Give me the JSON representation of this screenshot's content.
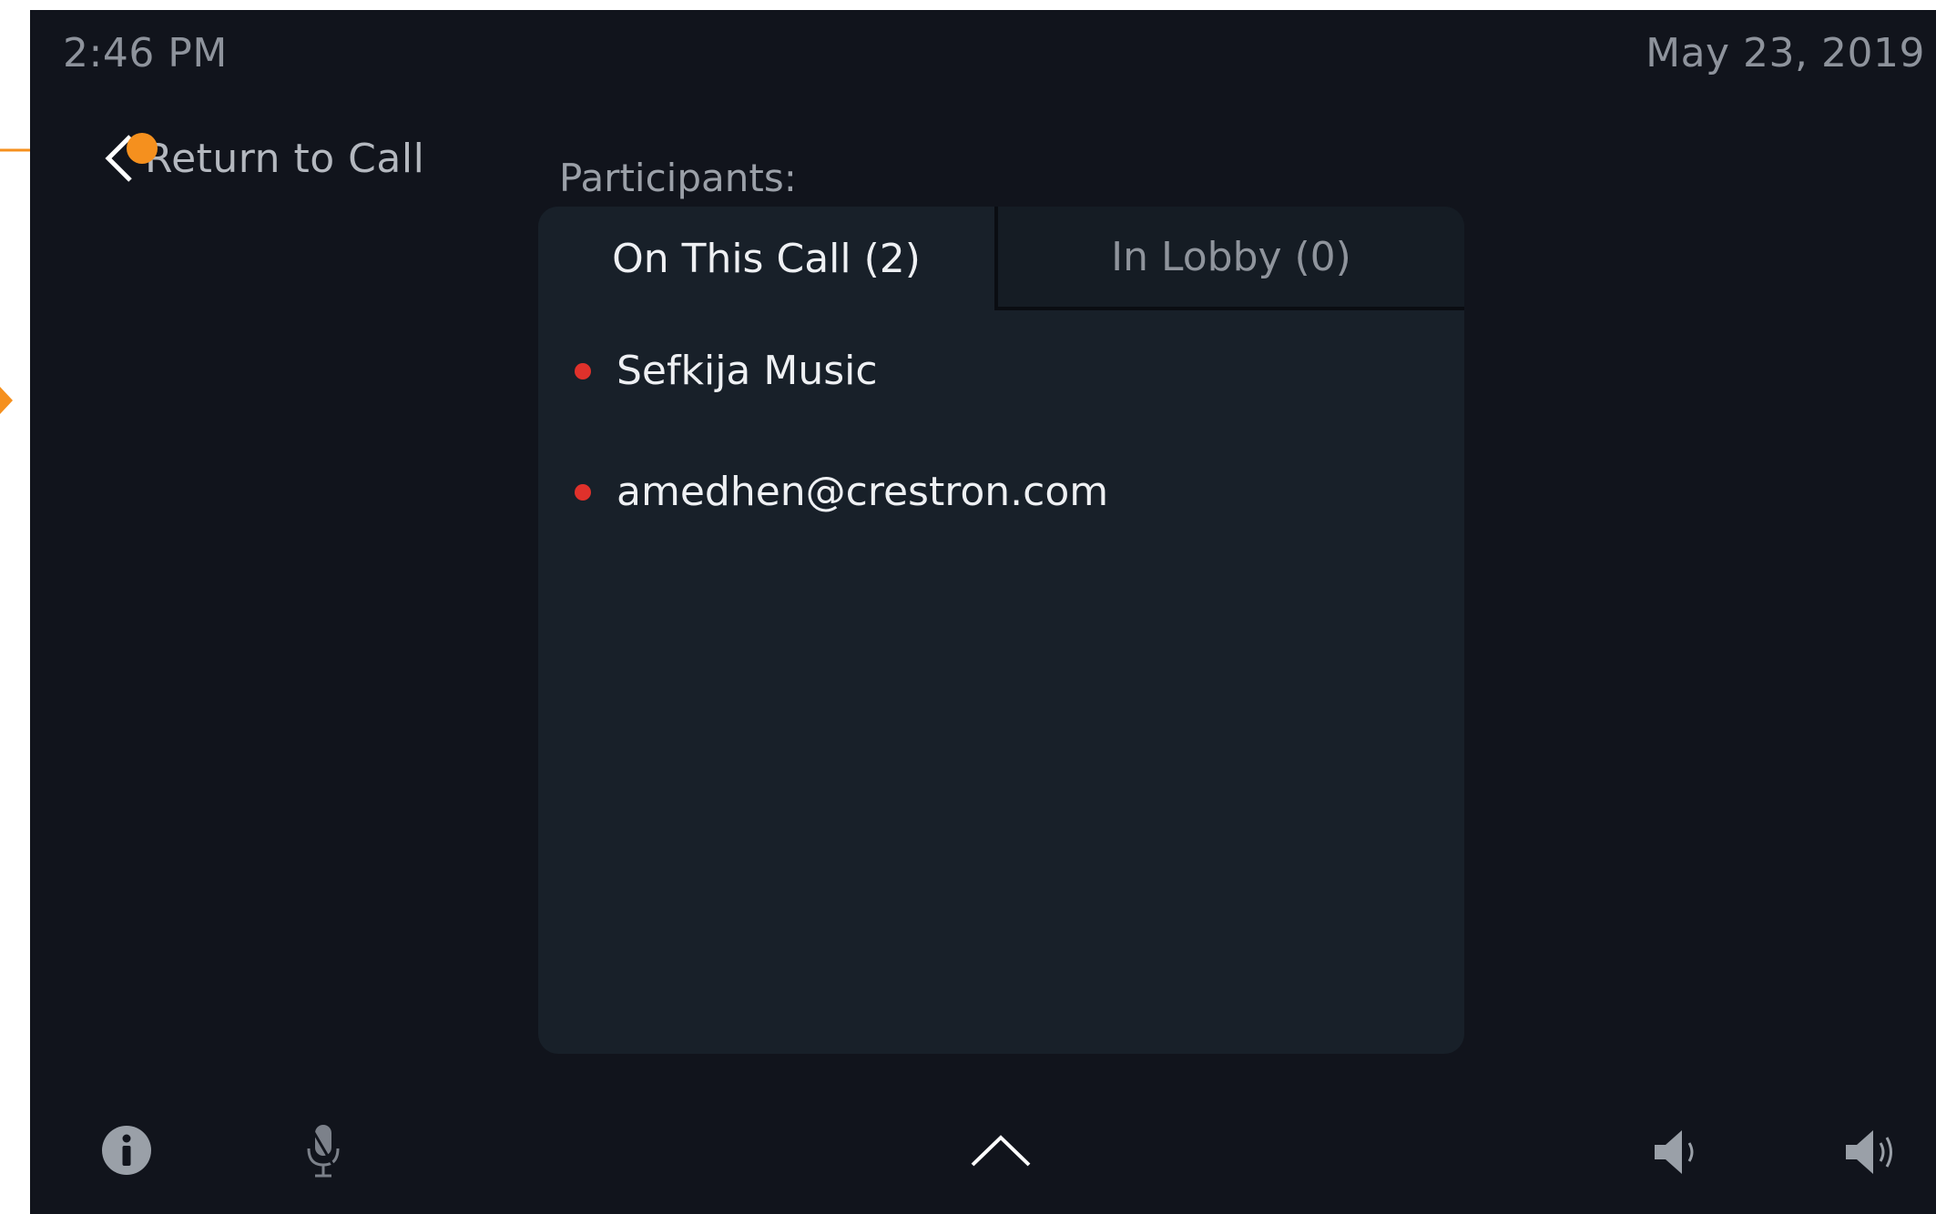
{
  "status_bar": {
    "time": "2:46 PM",
    "date": "May 23, 2019"
  },
  "navigation": {
    "back_label": "Return to Call",
    "back_icon": "chevron-left-icon"
  },
  "participants": {
    "heading": "Participants:",
    "tabs": [
      {
        "label": "On This Call (2)",
        "active": true
      },
      {
        "label": "In Lobby (0)",
        "active": false
      }
    ],
    "list": [
      {
        "name": "Sefkija Music",
        "status_color": "#e0312b"
      },
      {
        "name": "amedhen@crestron.com",
        "status_color": "#e0312b"
      }
    ]
  },
  "bottom_bar": {
    "icons": [
      "info-icon",
      "microphone-muted-icon",
      "chevron-up-icon",
      "volume-down-icon",
      "volume-up-icon"
    ]
  },
  "colors": {
    "background": "#11141c",
    "panel": "#182029",
    "annotation": "#f5901e",
    "status_dot": "#e0312b"
  }
}
